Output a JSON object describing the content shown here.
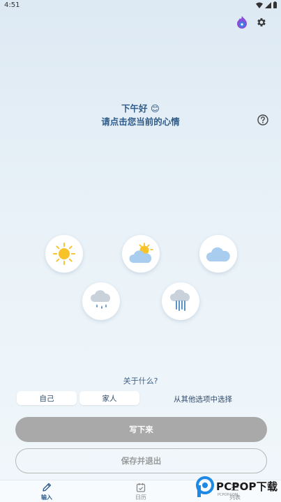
{
  "status": {
    "time": "4:51"
  },
  "greeting": {
    "line1": "下午好 😊",
    "line2": "请点击您当前的心情"
  },
  "moods": [
    {
      "name": "sunny"
    },
    {
      "name": "partly-cloudy"
    },
    {
      "name": "cloudy"
    },
    {
      "name": "light-rain"
    },
    {
      "name": "heavy-rain"
    }
  ],
  "about": {
    "label": "关于什么?",
    "chips": [
      "自己",
      "家人"
    ],
    "other": "从其他选项中选择"
  },
  "actions": {
    "write": "写下来",
    "save": "保存并退出"
  },
  "nav": {
    "items": [
      {
        "label": "输入"
      },
      {
        "label": "日历"
      },
      {
        "label": "列表"
      }
    ]
  },
  "watermark": {
    "text": "PCPOP下载",
    "sub": "PCPOP.COM"
  },
  "colors": {
    "accent": "#2f5c8a",
    "sun": "#f7c22a",
    "cloud": "#a8cdee",
    "rain": "#5a93c8"
  }
}
